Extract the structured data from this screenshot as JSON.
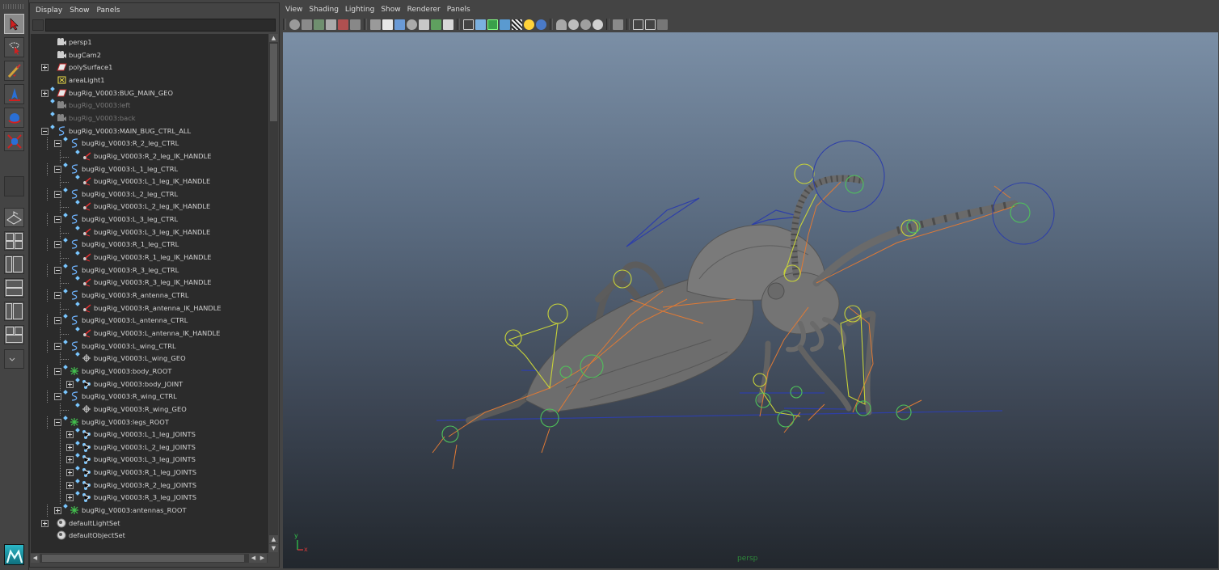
{
  "outliner": {
    "menu": [
      "Display",
      "Show",
      "Panels"
    ],
    "items": [
      {
        "label": "persp1",
        "icon": "camera-icon",
        "dim": false
      },
      {
        "label": "bugCam2",
        "icon": "camera-icon",
        "dim": false
      },
      {
        "label": "polySurface1",
        "icon": "mesh-icon",
        "dim": false
      },
      {
        "label": "areaLight1",
        "icon": "light-icon",
        "dim": false
      },
      {
        "label": "bugRig_V0003:BUG_MAIN_GEO",
        "icon": "mesh-icon",
        "dim": false
      },
      {
        "label": "bugRig_V0003:left",
        "icon": "camera-icon",
        "dim": true
      },
      {
        "label": "bugRig_V0003:back",
        "icon": "camera-icon",
        "dim": true
      },
      {
        "label": "bugRig_V0003:MAIN_BUG_CTRL_ALL",
        "icon": "curve-icon",
        "dim": false
      },
      {
        "label": "bugRig_V0003:R_2_leg_CTRL",
        "icon": "curve-icon",
        "dim": false
      },
      {
        "label": "bugRig_V0003:R_2_leg_IK_HANDLE",
        "icon": "ik-handle-icon",
        "dim": false
      },
      {
        "label": "bugRig_V0003:L_1_leg_CTRL",
        "icon": "curve-icon",
        "dim": false
      },
      {
        "label": "bugRig_V0003:L_1_leg_IK_HANDLE",
        "icon": "ik-handle-icon",
        "dim": false
      },
      {
        "label": "bugRig_V0003:L_2_leg_CTRL",
        "icon": "curve-icon",
        "dim": false
      },
      {
        "label": "bugRig_V0003:L_2_leg_IK_HANDLE",
        "icon": "ik-handle-icon",
        "dim": false
      },
      {
        "label": "bugRig_V0003:L_3_leg_CTRL",
        "icon": "curve-icon",
        "dim": false
      },
      {
        "label": "bugRig_V0003:L_3_leg_IK_HANDLE",
        "icon": "ik-handle-icon",
        "dim": false
      },
      {
        "label": "bugRig_V0003:R_1_leg_CTRL",
        "icon": "curve-icon",
        "dim": false
      },
      {
        "label": "bugRig_V0003:R_1_leg_IK_HANDLE",
        "icon": "ik-handle-icon",
        "dim": false
      },
      {
        "label": "bugRig_V0003:R_3_leg_CTRL",
        "icon": "curve-icon",
        "dim": false
      },
      {
        "label": "bugRig_V0003:R_3_leg_IK_HANDLE",
        "icon": "ik-handle-icon",
        "dim": false
      },
      {
        "label": "bugRig_V0003:R_antenna_CTRL",
        "icon": "curve-icon",
        "dim": false
      },
      {
        "label": "bugRig_V0003:R_antenna_IK_HANDLE",
        "icon": "ik-handle-icon",
        "dim": false
      },
      {
        "label": "bugRig_V0003:L_antenna_CTRL",
        "icon": "curve-icon",
        "dim": false
      },
      {
        "label": "bugRig_V0003:L_antenna_IK_HANDLE",
        "icon": "ik-handle-icon",
        "dim": false
      },
      {
        "label": "bugRig_V0003:L_wing_CTRL",
        "icon": "curve-icon",
        "dim": false
      },
      {
        "label": "bugRig_V0003:L_wing_GEO",
        "icon": "wing-geo-icon",
        "dim": false
      },
      {
        "label": "bugRig_V0003:body_ROOT",
        "icon": "group-icon",
        "dim": false
      },
      {
        "label": "bugRig_V0003:body_JOINT",
        "icon": "joint-icon",
        "dim": false
      },
      {
        "label": "bugRig_V0003:R_wing_CTRL",
        "icon": "curve-icon",
        "dim": false
      },
      {
        "label": "bugRig_V0003:R_wing_GEO",
        "icon": "wing-geo-icon",
        "dim": false
      },
      {
        "label": "bugRig_V0003:legs_ROOT",
        "icon": "group-icon",
        "dim": false
      },
      {
        "label": "bugRig_V0003:L_1_leg_JOINTS",
        "icon": "joint-icon",
        "dim": false
      },
      {
        "label": "bugRig_V0003:L_2_leg_JOINTS",
        "icon": "joint-icon",
        "dim": false
      },
      {
        "label": "bugRig_V0003:L_3_leg_JOINTS",
        "icon": "joint-icon",
        "dim": false
      },
      {
        "label": "bugRig_V0003:R_1_leg_JOINTS",
        "icon": "joint-icon",
        "dim": false
      },
      {
        "label": "bugRig_V0003:R_2_leg_JOINTS",
        "icon": "joint-icon",
        "dim": false
      },
      {
        "label": "bugRig_V0003:R_3_leg_JOINTS",
        "icon": "joint-icon",
        "dim": false
      },
      {
        "label": "bugRig_V0003:antennas_ROOT",
        "icon": "group-icon",
        "dim": false
      },
      {
        "label": "defaultLightSet",
        "icon": "set-icon",
        "dim": false
      },
      {
        "label": "defaultObjectSet",
        "icon": "set-icon",
        "dim": false
      }
    ]
  },
  "viewport": {
    "menu": [
      "View",
      "Shading",
      "Lighting",
      "Show",
      "Renderer",
      "Panels"
    ],
    "camera_label": "persp",
    "axis": {
      "y": "y",
      "x": "x"
    }
  },
  "colors": {
    "panel_bg": "#444444",
    "tree_bg": "#2b2b2b",
    "ctrl_yellow": "#c7d23a",
    "ctrl_blue": "#2e3fa8",
    "joint_orange": "#e07a35",
    "ik_green": "#4fc35a",
    "mesh_grey": "#6d6d6d"
  }
}
